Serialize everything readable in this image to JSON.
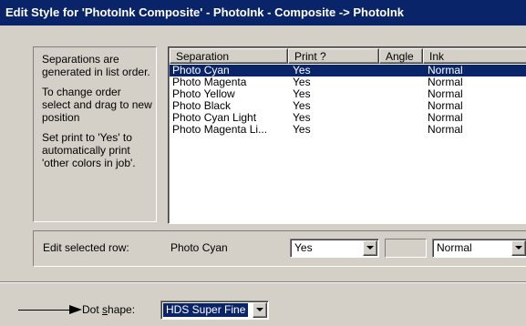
{
  "window": {
    "title": "Edit Style for 'PhotoInk Composite' - PhotoInk - Composite -> PhotoInk"
  },
  "info": {
    "paragraphs": [
      "Separations are generated in list order.",
      "To change order select and drag to new position",
      "Set print to 'Yes' to automatically print 'other colors in job'."
    ]
  },
  "list": {
    "columns": [
      "Separation",
      "Print ?",
      "Angle",
      "Ink"
    ],
    "rows": [
      {
        "separation": "Photo Cyan",
        "print": "Yes",
        "angle": "",
        "ink": "Normal",
        "selected": true
      },
      {
        "separation": "Photo Magenta",
        "print": "Yes",
        "angle": "",
        "ink": "Normal",
        "selected": false
      },
      {
        "separation": "Photo Yellow",
        "print": "Yes",
        "angle": "",
        "ink": "Normal",
        "selected": false
      },
      {
        "separation": "Photo Black",
        "print": "Yes",
        "angle": "",
        "ink": "Normal",
        "selected": false
      },
      {
        "separation": "Photo Cyan Light",
        "print": "Yes",
        "angle": "",
        "ink": "Normal",
        "selected": false
      },
      {
        "separation": "Photo Magenta Li...",
        "print": "Yes",
        "angle": "",
        "ink": "Normal",
        "selected": false
      }
    ]
  },
  "edit_row": {
    "label": "Edit selected row:",
    "separation_value": "Photo Cyan",
    "print_value": "Yes",
    "angle_value": "",
    "ink_value": "Normal"
  },
  "dot_shape": {
    "label_prefix": "Dot ",
    "label_accel": "s",
    "label_suffix": "hape:",
    "value": "HDS Super Fine"
  },
  "colors": {
    "titlebar": "#0a246a",
    "selection": "#0a246a",
    "face": "#d4d0c8"
  }
}
